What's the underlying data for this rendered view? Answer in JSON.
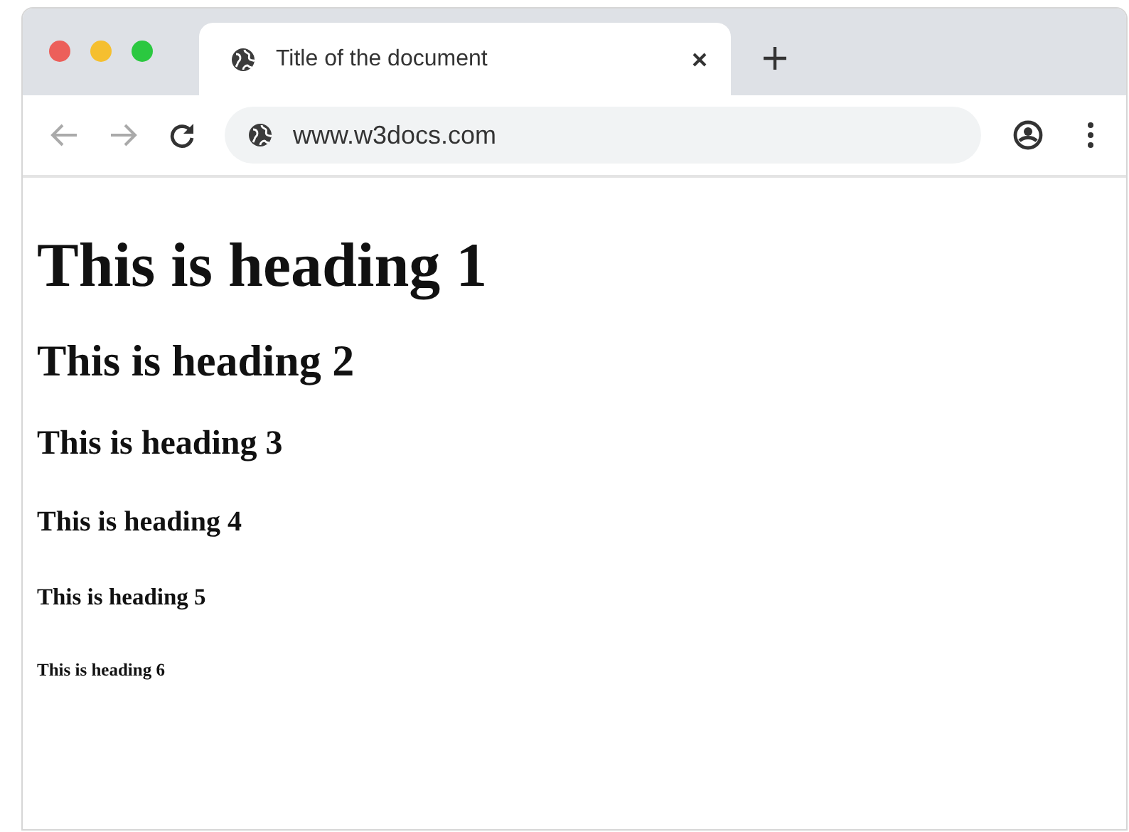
{
  "tab": {
    "title": "Title of the document",
    "selected": true
  },
  "address_bar": {
    "url": "www.w3docs.com"
  },
  "headings": [
    {
      "kind": "h1",
      "text": "This is heading 1"
    },
    {
      "kind": "h2",
      "text": "This is heading 2"
    },
    {
      "kind": "h3",
      "text": "This is heading 3"
    },
    {
      "kind": "h4",
      "text": "This is heading 4"
    },
    {
      "kind": "h5",
      "text": "This is heading 5"
    },
    {
      "kind": "h6",
      "text": "This is heading 6"
    }
  ]
}
